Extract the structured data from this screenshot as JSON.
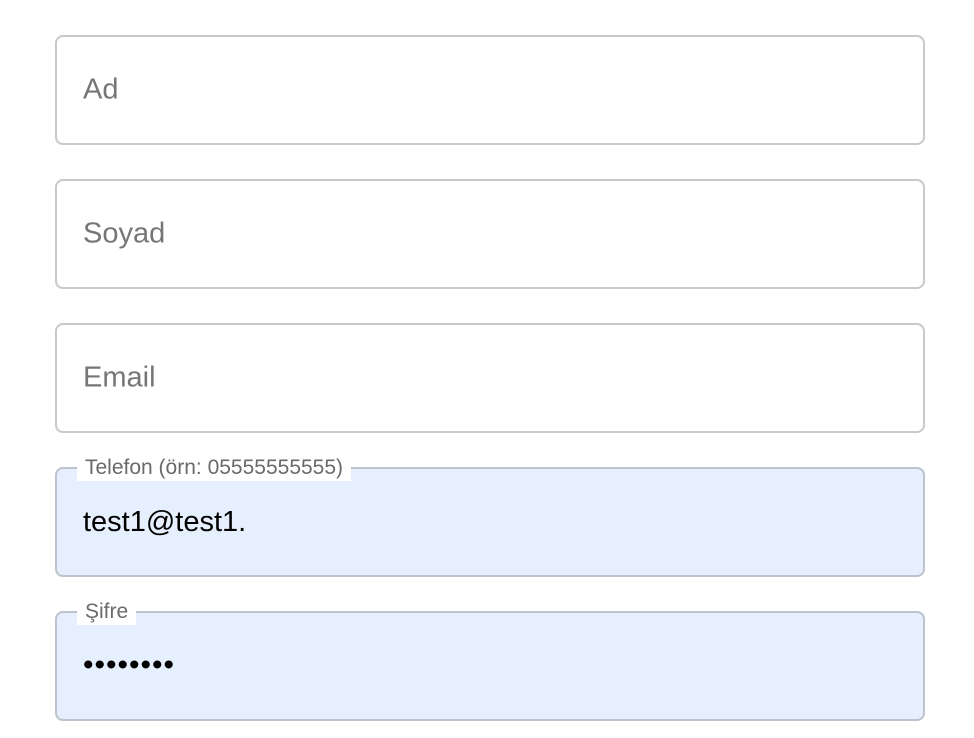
{
  "form": {
    "first_name": {
      "placeholder": "Ad"
    },
    "last_name": {
      "placeholder": "Soyad"
    },
    "email": {
      "placeholder": "Email"
    },
    "phone": {
      "label": "Telefon (örn: 05555555555)",
      "value": "test1@test1."
    },
    "password": {
      "label": "Şifre",
      "value": "••••••••"
    }
  },
  "colors": {
    "autofill_background": "#e5effd",
    "border": "#c9c9c9",
    "placeholder_text": "#767676",
    "label_text": "#6a6a6a"
  }
}
